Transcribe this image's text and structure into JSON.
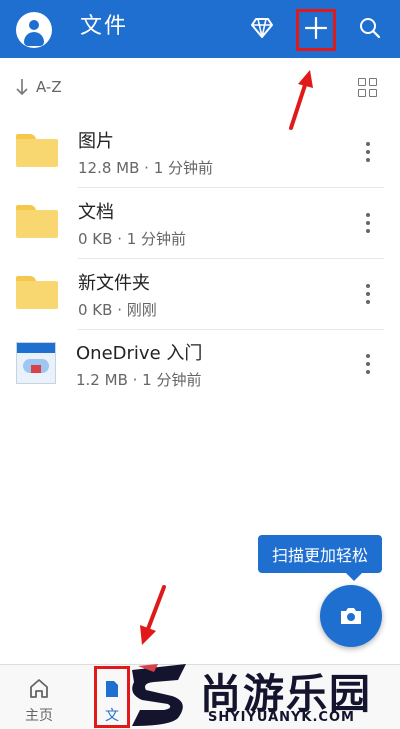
{
  "header": {
    "title": "文件",
    "icons": [
      "account-icon",
      "premium-diamond-icon",
      "add-icon",
      "search-icon"
    ],
    "color": "#1f6fd0"
  },
  "sort": {
    "label": "A-Z"
  },
  "files": [
    {
      "name": "图片",
      "meta": "12.8 MB · 1 分钟前",
      "kind": "folder"
    },
    {
      "name": "文档",
      "meta": "0 KB · 1 分钟前",
      "kind": "folder"
    },
    {
      "name": "新文件夹",
      "meta": "0 KB · 刚刚",
      "kind": "folder"
    },
    {
      "name": "OneDrive 入门",
      "meta": "1.2 MB · 1 分钟前",
      "kind": "document"
    }
  ],
  "tooltip": {
    "text": "扫描更加轻松"
  },
  "bottom_nav": {
    "home_label": "主页",
    "files_label": "文"
  },
  "watermark": {
    "text": "尚游乐园",
    "subtext": "SHYIYUANYK.COM"
  },
  "annotation_color": "#e01a1a"
}
